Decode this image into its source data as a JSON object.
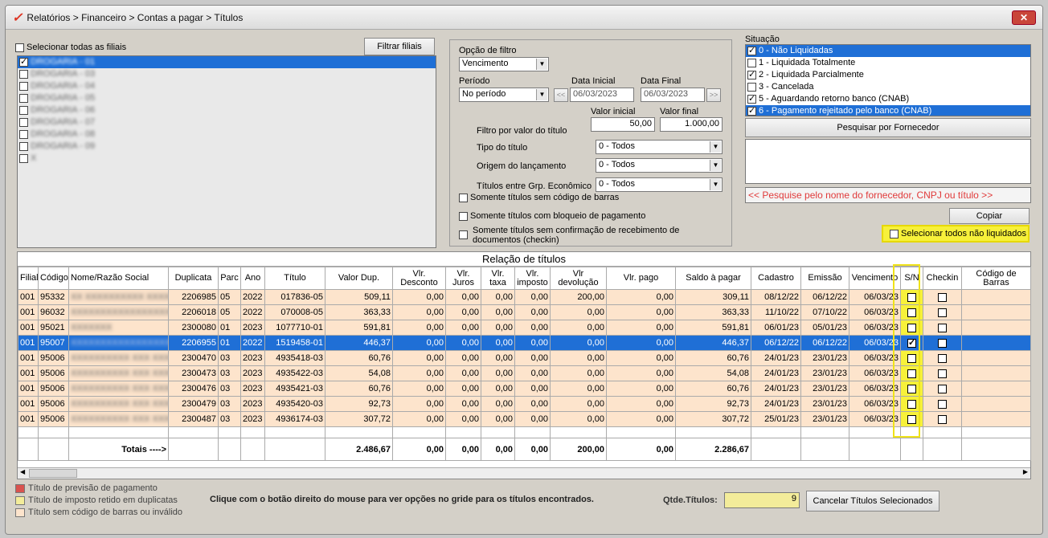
{
  "window": {
    "title": "Relatórios > Financeiro > Contas a pagar > Títulos",
    "close": "✕"
  },
  "filiais": {
    "select_all_label": "Selecionar todas as filiais",
    "filter_button": "Filtrar filiais",
    "items": [
      {
        "label": "DROGARIA - 01",
        "checked": true,
        "selected": true
      },
      {
        "label": "DROGARIA - 03",
        "checked": false
      },
      {
        "label": "DROGARIA - 04",
        "checked": false
      },
      {
        "label": "DROGARIA - 05",
        "checked": false
      },
      {
        "label": "DROGARIA - 06",
        "checked": false
      },
      {
        "label": "DROGARIA - 07",
        "checked": false
      },
      {
        "label": "DROGARIA - 08",
        "checked": false
      },
      {
        "label": "DROGARIA - 09",
        "checked": false
      },
      {
        "label": "X",
        "checked": false
      }
    ]
  },
  "filtro": {
    "opcao_label": "Opção de filtro",
    "opcao_value": "Vencimento",
    "periodo_label": "Período",
    "periodo_value": "No período",
    "data_inicial_label": "Data Inicial",
    "data_inicial": "06/03/2023",
    "data_final_label": "Data Final",
    "data_final": "06/03/2023",
    "prev_btn": "<<",
    "next_btn": ">>",
    "valor_inicial_label": "Valor inicial",
    "valor_final_label": "Valor final",
    "valor_titulo_label": "Filtro por valor do título",
    "valor_inicial": "50,00",
    "valor_final": "1.000,00",
    "tipo_label": "Tipo do título",
    "tipo_value": "0 - Todos",
    "origem_label": "Origem do lançamento",
    "origem_value": "0 - Todos",
    "grp_label": "Títulos entre Grp. Econômico",
    "grp_value": "0 - Todos",
    "sem_codigo": "Somente títulos sem código de barras",
    "com_bloqueio": "Somente títulos com bloqueio de pagamento",
    "sem_confirmacao": "Somente títulos sem confirmação de recebimento de documentos (checkin)"
  },
  "situacao": {
    "label": "Situação",
    "items": [
      {
        "label": "0 - Não Liquidadas",
        "checked": true,
        "selected": true
      },
      {
        "label": "1 - Liquidada Totalmente",
        "checked": false
      },
      {
        "label": "2 - Liquidada Parcialmente",
        "checked": true
      },
      {
        "label": "3 - Cancelada",
        "checked": false
      },
      {
        "label": "5 - Aguardando retorno banco (CNAB)",
        "checked": true
      },
      {
        "label": "6 - Pagamento rejeitado pelo banco (CNAB)",
        "checked": true,
        "selected": true
      }
    ],
    "fornecedor_btn": "Pesquisar por Fornecedor",
    "search_hint": "<< Pesquise pelo nome do fornecedor, CNPJ ou título >>",
    "copiar": "Copiar",
    "select_nao_liquidados": "Selecionar todos não liquidados"
  },
  "grid": {
    "title": "Relação de títulos",
    "columns": [
      "Filial",
      "Código",
      "Nome/Razão Social",
      "Duplicata",
      "Parc",
      "Ano",
      "Título",
      "Valor Dup.",
      "Vlr. Desconto",
      "Vlr. Juros",
      "Vlr. taxa",
      "Vlr. imposto",
      "Vlr devolução",
      "Vlr. pago",
      "Saldo à pagar",
      "Cadastro",
      "Emissão",
      "Vencimento",
      "S/N",
      "Checkin",
      "Código de Barras"
    ],
    "rows": [
      {
        "filial": "001",
        "codigo": "95332",
        "nome": "XX XXXXXXXXXX XXXXX XX",
        "duplicata": "2206985",
        "parc": "05",
        "ano": "2022",
        "titulo": "017836-05",
        "valor": "509,11",
        "desc": "0,00",
        "juros": "0,00",
        "taxa": "0,00",
        "imposto": "0,00",
        "devol": "200,00",
        "pago": "0,00",
        "saldo": "309,11",
        "cadastro": "08/12/22",
        "emissao": "06/12/22",
        "venc": "06/03/23",
        "sn": false,
        "checkin": false,
        "selected": false
      },
      {
        "filial": "001",
        "codigo": "96032",
        "nome": "XXXXXXXXXXXXXXXXXXXX",
        "duplicata": "2206018",
        "parc": "05",
        "ano": "2022",
        "titulo": "070008-05",
        "valor": "363,33",
        "desc": "0,00",
        "juros": "0,00",
        "taxa": "0,00",
        "imposto": "0,00",
        "devol": "0,00",
        "pago": "0,00",
        "saldo": "363,33",
        "cadastro": "11/10/22",
        "emissao": "07/10/22",
        "venc": "06/03/23",
        "sn": false,
        "checkin": false,
        "selected": false
      },
      {
        "filial": "001",
        "codigo": "95021",
        "nome": "XXXXXXX",
        "duplicata": "2300080",
        "parc": "01",
        "ano": "2023",
        "titulo": "1077710-01",
        "valor": "591,81",
        "desc": "0,00",
        "juros": "0,00",
        "taxa": "0,00",
        "imposto": "0,00",
        "devol": "0,00",
        "pago": "0,00",
        "saldo": "591,81",
        "cadastro": "06/01/23",
        "emissao": "05/01/23",
        "venc": "06/03/23",
        "sn": false,
        "checkin": false,
        "selected": false
      },
      {
        "filial": "001",
        "codigo": "95007",
        "nome": "XXXXXXXXXXXXXXXXXXXX",
        "duplicata": "2206955",
        "parc": "01",
        "ano": "2022",
        "titulo": "1519458-01",
        "valor": "446,37",
        "desc": "0,00",
        "juros": "0,00",
        "taxa": "0,00",
        "imposto": "0,00",
        "devol": "0,00",
        "pago": "0,00",
        "saldo": "446,37",
        "cadastro": "06/12/22",
        "emissao": "06/12/22",
        "venc": "06/03/23",
        "sn": true,
        "checkin": false,
        "selected": true
      },
      {
        "filial": "001",
        "codigo": "95006",
        "nome": "XXXXXXXXXX XXX XXXX",
        "duplicata": "2300470",
        "parc": "03",
        "ano": "2023",
        "titulo": "4935418-03",
        "valor": "60,76",
        "desc": "0,00",
        "juros": "0,00",
        "taxa": "0,00",
        "imposto": "0,00",
        "devol": "0,00",
        "pago": "0,00",
        "saldo": "60,76",
        "cadastro": "24/01/23",
        "emissao": "23/01/23",
        "venc": "06/03/23",
        "sn": false,
        "checkin": false,
        "selected": false
      },
      {
        "filial": "001",
        "codigo": "95006",
        "nome": "XXXXXXXXXX XXX XXXX",
        "duplicata": "2300473",
        "parc": "03",
        "ano": "2023",
        "titulo": "4935422-03",
        "valor": "54,08",
        "desc": "0,00",
        "juros": "0,00",
        "taxa": "0,00",
        "imposto": "0,00",
        "devol": "0,00",
        "pago": "0,00",
        "saldo": "54,08",
        "cadastro": "24/01/23",
        "emissao": "23/01/23",
        "venc": "06/03/23",
        "sn": false,
        "checkin": false,
        "selected": false
      },
      {
        "filial": "001",
        "codigo": "95006",
        "nome": "XXXXXXXXXX XXX XXXX",
        "duplicata": "2300476",
        "parc": "03",
        "ano": "2023",
        "titulo": "4935421-03",
        "valor": "60,76",
        "desc": "0,00",
        "juros": "0,00",
        "taxa": "0,00",
        "imposto": "0,00",
        "devol": "0,00",
        "pago": "0,00",
        "saldo": "60,76",
        "cadastro": "24/01/23",
        "emissao": "23/01/23",
        "venc": "06/03/23",
        "sn": false,
        "checkin": false,
        "selected": false
      },
      {
        "filial": "001",
        "codigo": "95006",
        "nome": "XXXXXXXXXX XXX XXXX",
        "duplicata": "2300479",
        "parc": "03",
        "ano": "2023",
        "titulo": "4935420-03",
        "valor": "92,73",
        "desc": "0,00",
        "juros": "0,00",
        "taxa": "0,00",
        "imposto": "0,00",
        "devol": "0,00",
        "pago": "0,00",
        "saldo": "92,73",
        "cadastro": "24/01/23",
        "emissao": "23/01/23",
        "venc": "06/03/23",
        "sn": false,
        "checkin": false,
        "selected": false
      },
      {
        "filial": "001",
        "codigo": "95006",
        "nome": "XXXXXXXXXX XXX XXXX",
        "duplicata": "2300487",
        "parc": "03",
        "ano": "2023",
        "titulo": "4936174-03",
        "valor": "307,72",
        "desc": "0,00",
        "juros": "0,00",
        "taxa": "0,00",
        "imposto": "0,00",
        "devol": "0,00",
        "pago": "0,00",
        "saldo": "307,72",
        "cadastro": "25/01/23",
        "emissao": "23/01/23",
        "venc": "06/03/23",
        "sn": false,
        "checkin": false,
        "selected": false
      }
    ],
    "totals": {
      "label": "Totais ---->",
      "valor": "2.486,67",
      "desc": "0,00",
      "juros": "0,00",
      "taxa": "0,00",
      "imposto": "0,00",
      "devol": "200,00",
      "pago": "0,00",
      "saldo": "2.286,67"
    }
  },
  "footer": {
    "legend": [
      {
        "label": "Título de previsão de pagamento",
        "color": "#d9534f"
      },
      {
        "label": "Título de imposto retido em duplicatas",
        "color": "#f3ec9a"
      },
      {
        "label": "Título sem código de barras ou inválido",
        "color": "#fde4cc"
      }
    ],
    "hint": "Clique com o botão direito do mouse para ver opções no gride para os títulos encontrados.",
    "qtde_label": "Qtde.Títulos:",
    "qtde_value": "9",
    "cancel_btn": "Cancelar Títulos Selecionados"
  }
}
